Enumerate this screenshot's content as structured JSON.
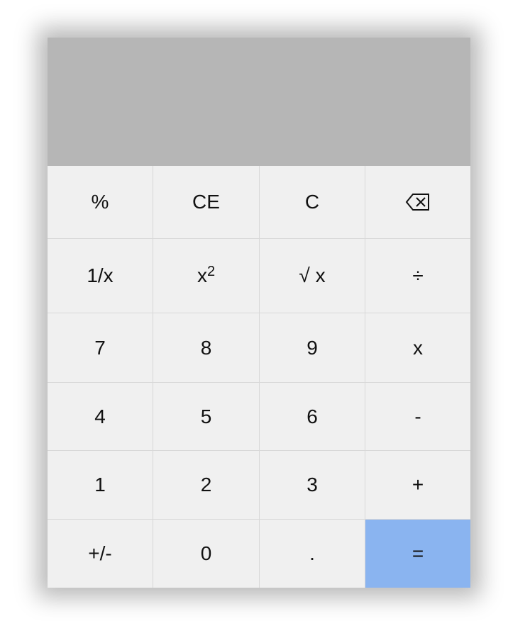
{
  "display": {
    "value": ""
  },
  "keys": {
    "percent": "%",
    "clear_entry": "CE",
    "clear": "C",
    "backspace_icon": "backspace-icon",
    "reciprocal": "1/x",
    "square_base": "x",
    "square_exp": "2",
    "sqrt": "√ x",
    "divide": "÷",
    "seven": "7",
    "eight": "8",
    "nine": "9",
    "multiply": "x",
    "four": "4",
    "five": "5",
    "six": "6",
    "minus": "-",
    "one": "1",
    "two": "2",
    "three": "3",
    "plus": "+",
    "negate": "+/-",
    "zero": "0",
    "decimal": ".",
    "equals": "="
  },
  "colors": {
    "display_bg": "#b6b6b6",
    "key_bg": "#f0f0f0",
    "equals_bg": "#8ab4f0"
  }
}
